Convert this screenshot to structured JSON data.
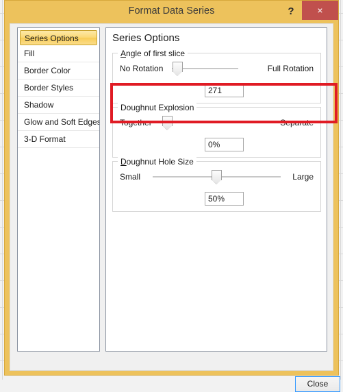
{
  "window": {
    "title": "Format Data Series",
    "help_label": "?",
    "close_x_label": "×",
    "titlebar_color": "#edc25c",
    "close_button_color": "#c0504d"
  },
  "sidebar": {
    "items": [
      {
        "label": "Series Options",
        "selected": true
      },
      {
        "label": "Fill",
        "selected": false
      },
      {
        "label": "Border Color",
        "selected": false
      },
      {
        "label": "Border Styles",
        "selected": false
      },
      {
        "label": "Shadow",
        "selected": false
      },
      {
        "label": "Glow and Soft Edges",
        "selected": false
      },
      {
        "label": "3-D Format",
        "selected": false
      }
    ]
  },
  "content": {
    "heading": "Series Options",
    "groups": [
      {
        "legend": "Angle of first slice",
        "accel": "A",
        "legend_rest": "ngle of first slice",
        "left_label": "No Rotation",
        "right_label": "Full Rotation",
        "value": "271",
        "thumb_percent": 1
      },
      {
        "legend": "Doughnut Explosion",
        "accel": "",
        "legend_rest": "Doughnut Explosion",
        "left_label": "Together",
        "right_label": "Separate",
        "value": "0%",
        "thumb_percent": 0
      },
      {
        "legend": "Doughnut Hole Size",
        "accel": "D",
        "legend_rest": "oughnut Hole Size",
        "left_label": "Small",
        "right_label": "Large",
        "value": "50%",
        "thumb_percent": 50
      }
    ]
  },
  "footer": {
    "close_label": "Close"
  },
  "annotation": {
    "highlight_color": "#e01b24"
  }
}
